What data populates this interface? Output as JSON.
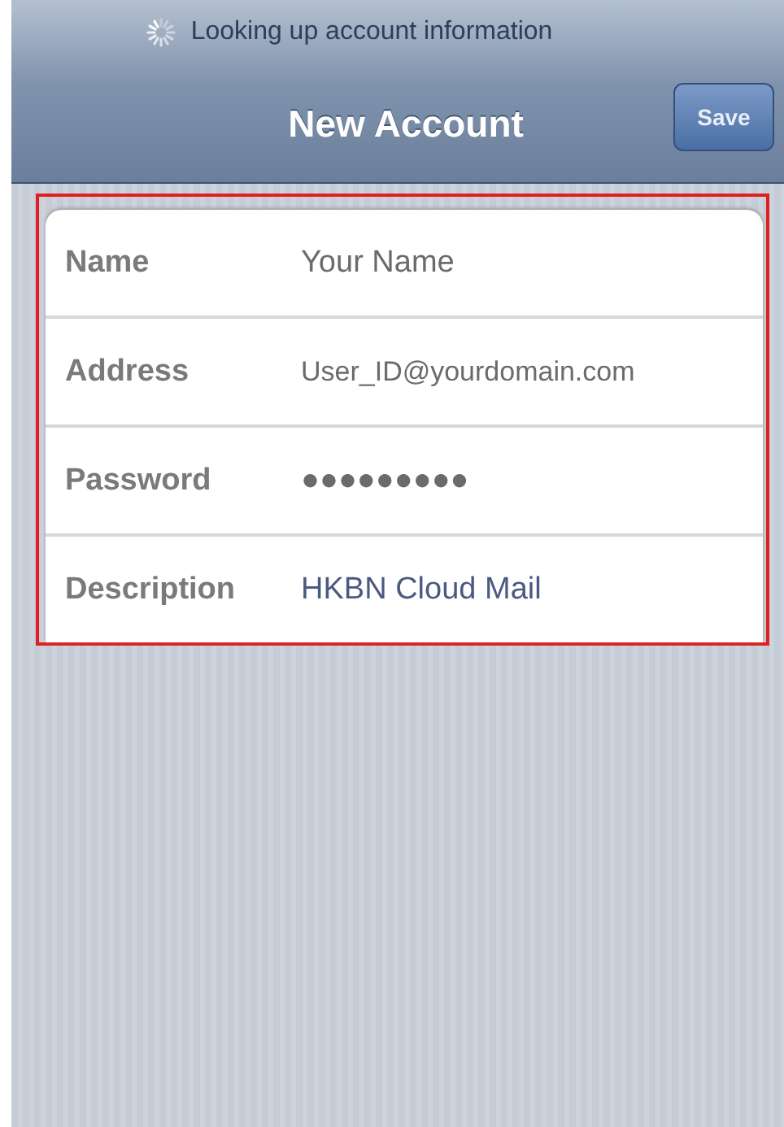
{
  "status_bar": {
    "text": "Looking up account information"
  },
  "nav_bar": {
    "title": "New Account",
    "save_button": "Save"
  },
  "fields": [
    {
      "label": "Name",
      "placeholder": "Your Name"
    },
    {
      "label": "Address",
      "placeholder": "User_ID@yourdomain.com"
    },
    {
      "label": "Password",
      "placeholder": "●●●●●●●●●"
    },
    {
      "label": "Description",
      "value": "HKBN Cloud Mail"
    }
  ],
  "highlight": {
    "color": "#e02020"
  }
}
